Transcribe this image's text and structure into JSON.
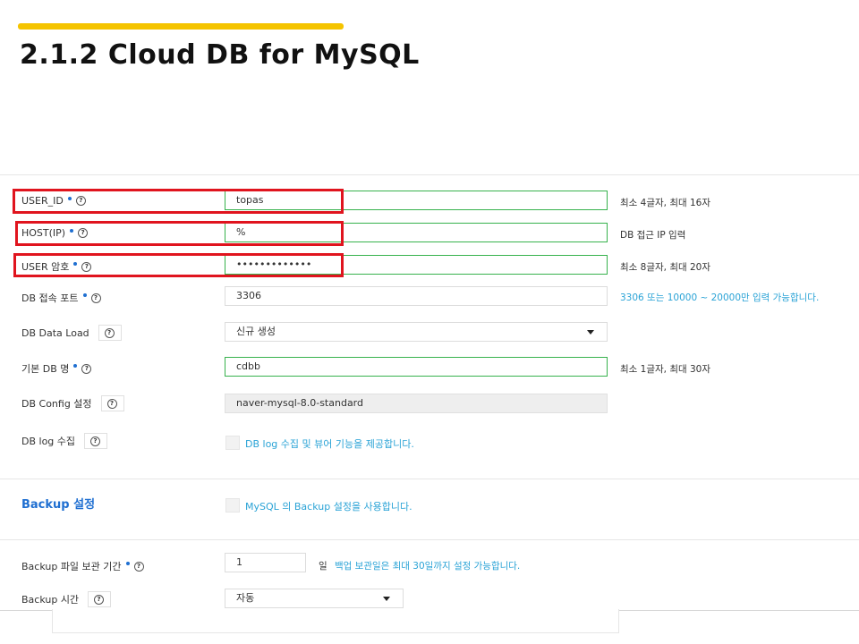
{
  "slide": {
    "title": "2.1.2 Cloud DB for MySQL",
    "accent_color": "#f5c400"
  },
  "form": {
    "user_id": {
      "label": "USER_ID",
      "value": "topas",
      "hint": "최소 4글자, 최대 16자"
    },
    "host_ip": {
      "label": "HOST(IP)",
      "value": "%",
      "hint": "DB 접근 IP 입력"
    },
    "user_password": {
      "label": "USER 암호",
      "value": "•••••••••••••",
      "hint": "최소 8글자, 최대 20자"
    },
    "db_port": {
      "label": "DB 접속 포트",
      "value": "3306",
      "hint": "3306 또는 10000 ~ 20000만 입력 가능합니다."
    },
    "db_data_load": {
      "label": "DB Data Load",
      "value": "신규 생성"
    },
    "default_db_name": {
      "label": "기본 DB 명",
      "value": "cdbb",
      "hint": "최소 1글자, 최대 30자"
    },
    "db_config": {
      "label": "DB Config 설정",
      "value": "naver-mysql-8.0-standard"
    },
    "db_log": {
      "label": "DB log 수집",
      "checkbox_label": "DB log 수집 및 뷰어 기능을 제공합니다."
    },
    "backup": {
      "section_title": "Backup 설정",
      "checkbox_label": "MySQL 의 Backup 설정을 사용합니다."
    },
    "backup_retention": {
      "label": "Backup 파일 보관 기간",
      "value": "1",
      "unit": "일",
      "hint": "백업 보관일은 최대 30일까지 설정 가능합니다."
    },
    "backup_time": {
      "label": "Backup 시간",
      "value": "자동"
    }
  },
  "icons": {
    "help": "?"
  },
  "colors": {
    "highlight": "#e0141e",
    "valid_border": "#37b24d",
    "info_text": "#2aa3d6",
    "section_title": "#1f6fd1"
  }
}
